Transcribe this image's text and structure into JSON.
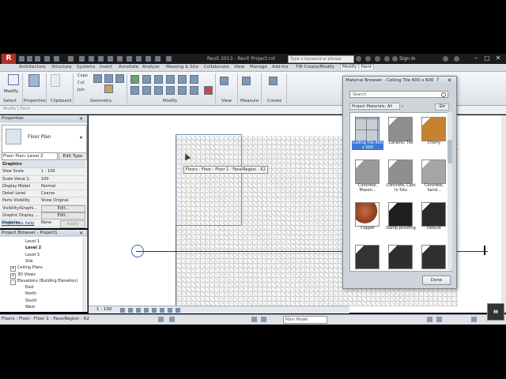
{
  "titlebar": {
    "app_button": "R",
    "doc_title": "Revit 2013 - Revit Project.rvt",
    "search_placeholder": "Type a keyword or phrase",
    "signin": "Sign In"
  },
  "tabs": [
    "Architecture",
    "Structure",
    "Systems",
    "Insert",
    "Annotate",
    "Analyze",
    "Massing & Site",
    "Collaborate",
    "View",
    "Manage",
    "Add-Ins",
    "TIR Create/Modify",
    "Modify | Paint"
  ],
  "ribbon": {
    "modify_label": "Modify",
    "clipboard_small": [
      "Cope",
      "Cut",
      "Join"
    ],
    "panels": [
      "Select",
      "Properties",
      "Clipboard",
      "Geometry",
      "Modify",
      "View",
      "Measure",
      "Create"
    ]
  },
  "optbar": {
    "label": "Modify | Paint"
  },
  "properties": {
    "header": "Properties",
    "type_name": "Floor Plan",
    "instance_selector": "Floor Plan: Level 2",
    "edit_type": "Edit Type",
    "rows": [
      {
        "k": "Graphics",
        "v": "",
        "group": true
      },
      {
        "k": "View Scale",
        "v": "1 : 100"
      },
      {
        "k": "Scale Value  1:",
        "v": "100"
      },
      {
        "k": "Display Model",
        "v": "Normal"
      },
      {
        "k": "Detail Level",
        "v": "Coarse"
      },
      {
        "k": "Parts Visibility",
        "v": "Show Original"
      },
      {
        "k": "Visibility/Graphi...",
        "v": "Edit...",
        "button": true
      },
      {
        "k": "Graphic Display ...",
        "v": "Edit...",
        "button": true
      },
      {
        "k": "Underlay",
        "v": "None"
      }
    ],
    "help": "Properties help",
    "apply": "Apply"
  },
  "browser": {
    "header": "Project Browser - Project1",
    "items": [
      {
        "label": "Level 1",
        "indent": 32,
        "bold": false
      },
      {
        "label": "Level 2",
        "indent": 32,
        "bold": true
      },
      {
        "label": "Level 3",
        "indent": 32,
        "bold": false
      },
      {
        "label": "Site",
        "indent": 32,
        "bold": false
      },
      {
        "label": "Ceiling Plans",
        "indent": 22,
        "bold": false,
        "exp": "+"
      },
      {
        "label": "3D Views",
        "indent": 22,
        "bold": false,
        "exp": "+"
      },
      {
        "label": "Elevations (Building Elevation)",
        "indent": 22,
        "bold": false,
        "exp": "-"
      },
      {
        "label": "East",
        "indent": 32,
        "bold": false
      },
      {
        "label": "North",
        "indent": 32,
        "bold": false
      },
      {
        "label": "South",
        "indent": 32,
        "bold": false
      },
      {
        "label": "West",
        "indent": 32,
        "bold": false
      }
    ]
  },
  "canvas": {
    "tooltip": "Floors : Floor : Floor 1 : Face/Region : R2"
  },
  "viewbar": {
    "scale": "1 : 100"
  },
  "status": {
    "text": "Floors : Floor : Floor 1 : Face/Region : R2",
    "model": "Main Model"
  },
  "material_browser": {
    "title": "Material Browser - Ceiling Tile 600 x 600",
    "search_placeholder": "Search",
    "filter": "Project Materials: All",
    "done": "Done",
    "materials": [
      {
        "label": "Ceiling Tile 600 x 600",
        "color": "#c9ced4",
        "selected": true,
        "grid": true
      },
      {
        "label": "Ceramic Tile",
        "color": "#8e8e8e"
      },
      {
        "label": "Cherry",
        "color": "#c7822f"
      },
      {
        "label": "Concrete, Mason...",
        "color": "#9a9a9a"
      },
      {
        "label": "Concrete, Cast In Situ",
        "color": "#8f8f8f"
      },
      {
        "label": "Concrete, Sand...",
        "color": "#a5a5a5"
      },
      {
        "label": "Copper",
        "color": "#8a3a1c",
        "round": true
      },
      {
        "label": "Damp-proofing",
        "color": "#1e1e1e"
      },
      {
        "label": "Default",
        "color": "#2a2a2a"
      },
      {
        "label": "",
        "color": "#333333"
      },
      {
        "label": "",
        "color": "#2e2e2e"
      },
      {
        "label": "",
        "color": "#303030"
      }
    ]
  }
}
